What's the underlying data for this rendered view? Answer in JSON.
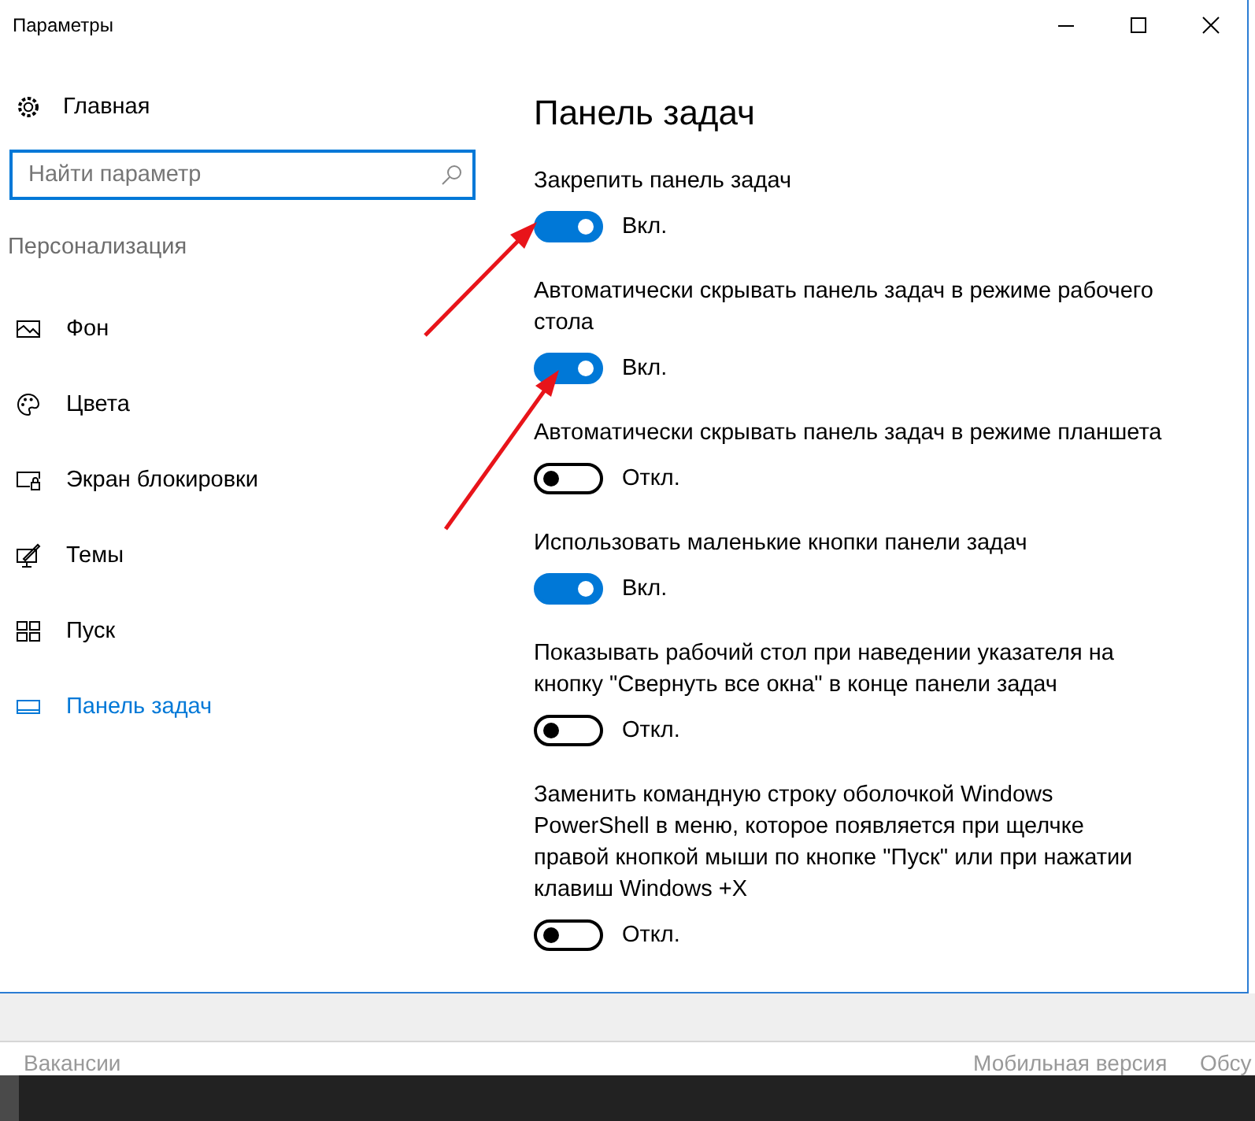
{
  "window": {
    "title": "Параметры"
  },
  "sidebar": {
    "home": "Главная",
    "search": {
      "placeholder": "Найти параметр"
    },
    "section": "Персонализация",
    "items": [
      {
        "label": "Фон",
        "selected": false
      },
      {
        "label": "Цвета",
        "selected": false
      },
      {
        "label": "Экран блокировки",
        "selected": false
      },
      {
        "label": "Темы",
        "selected": false
      },
      {
        "label": "Пуск",
        "selected": false
      },
      {
        "label": "Панель задач",
        "selected": true
      }
    ]
  },
  "page": {
    "title": "Панель задач",
    "settings": [
      {
        "label": "Закрепить панель задач",
        "on": true,
        "state_text": "Вкл."
      },
      {
        "label": "Автоматически скрывать панель задач в режиме рабочего стола",
        "on": true,
        "state_text": "Вкл."
      },
      {
        "label": "Автоматически скрывать панель задач в режиме планшета",
        "on": false,
        "state_text": "Откл."
      },
      {
        "label": "Использовать маленькие кнопки панели задач",
        "on": true,
        "state_text": "Вкл."
      },
      {
        "label": "Показывать рабочий стол при наведении указателя на кнопку \"Свернуть все окна\" в конце панели задач",
        "on": false,
        "state_text": "Откл."
      },
      {
        "label": "Заменить командную строку оболочкой Windows PowerShell в меню, которое появляется при щелчке правой кнопкой мыши по кнопке \"Пуск\" или при нажатии клавиш Windows +X",
        "on": false,
        "state_text": "Откл."
      }
    ]
  },
  "footer": {
    "links": [
      "Вакансии",
      "Мобильная версия",
      "Обсу"
    ]
  }
}
